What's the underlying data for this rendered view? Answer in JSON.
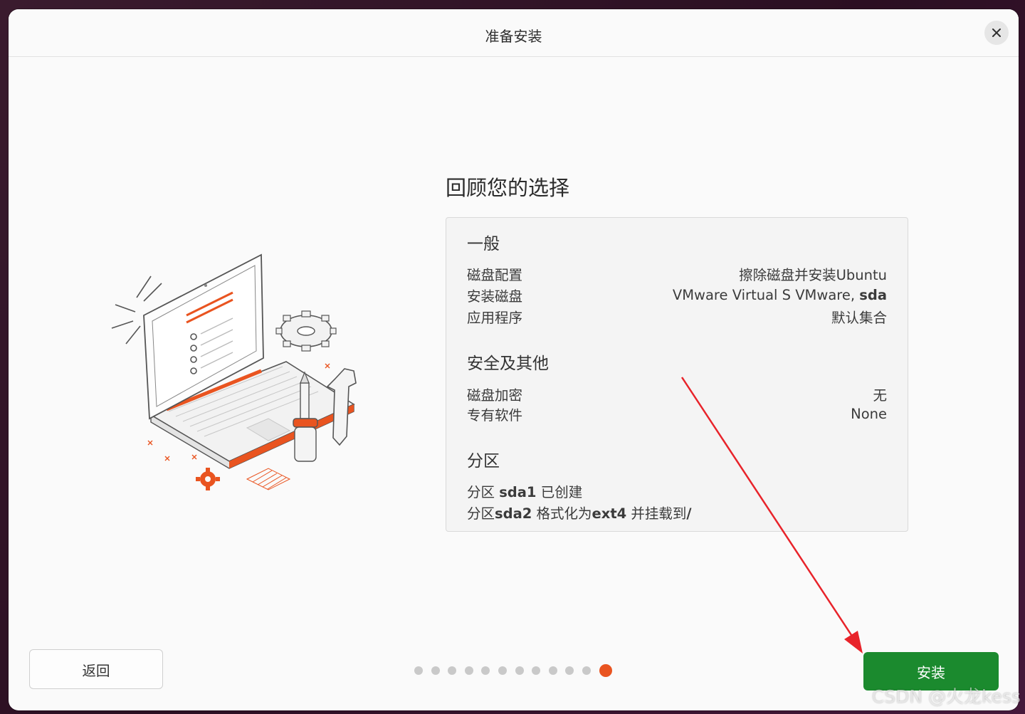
{
  "window": {
    "title": "准备安装",
    "close_icon": "close-icon"
  },
  "main": {
    "heading": "回顾您的选择",
    "general": {
      "title": "一般",
      "rows": [
        {
          "label": "磁盘配置",
          "value": "擦除磁盘并安装Ubuntu"
        },
        {
          "label": "安装磁盘",
          "value_prefix": "VMware Virtual S VMware, ",
          "value_bold": "sda"
        },
        {
          "label": "应用程序",
          "value": "默认集合"
        }
      ]
    },
    "security": {
      "title": "安全及其他",
      "rows": [
        {
          "label": "磁盘加密",
          "value": "无"
        },
        {
          "label": "专有软件",
          "value": "None"
        }
      ]
    },
    "partitions": {
      "title": "分区",
      "line1_prefix": "分区 ",
      "line1_bold": "sda1",
      "line1_suffix": " 已创建",
      "line2_prefix": "分区",
      "line2_bold": "sda2",
      "line2_mid": " 格式化为",
      "line2_bold2": "ext4",
      "line2_mid2": " 并挂载到",
      "line2_bold3": "/"
    }
  },
  "footer": {
    "back_label": "返回",
    "install_label": "安装",
    "page_total": 12,
    "page_current": 12
  },
  "colors": {
    "accent": "#e95420",
    "install": "#1b8a2e",
    "annotation": "#e8232a"
  },
  "watermark": "CSDN @火龙kess"
}
